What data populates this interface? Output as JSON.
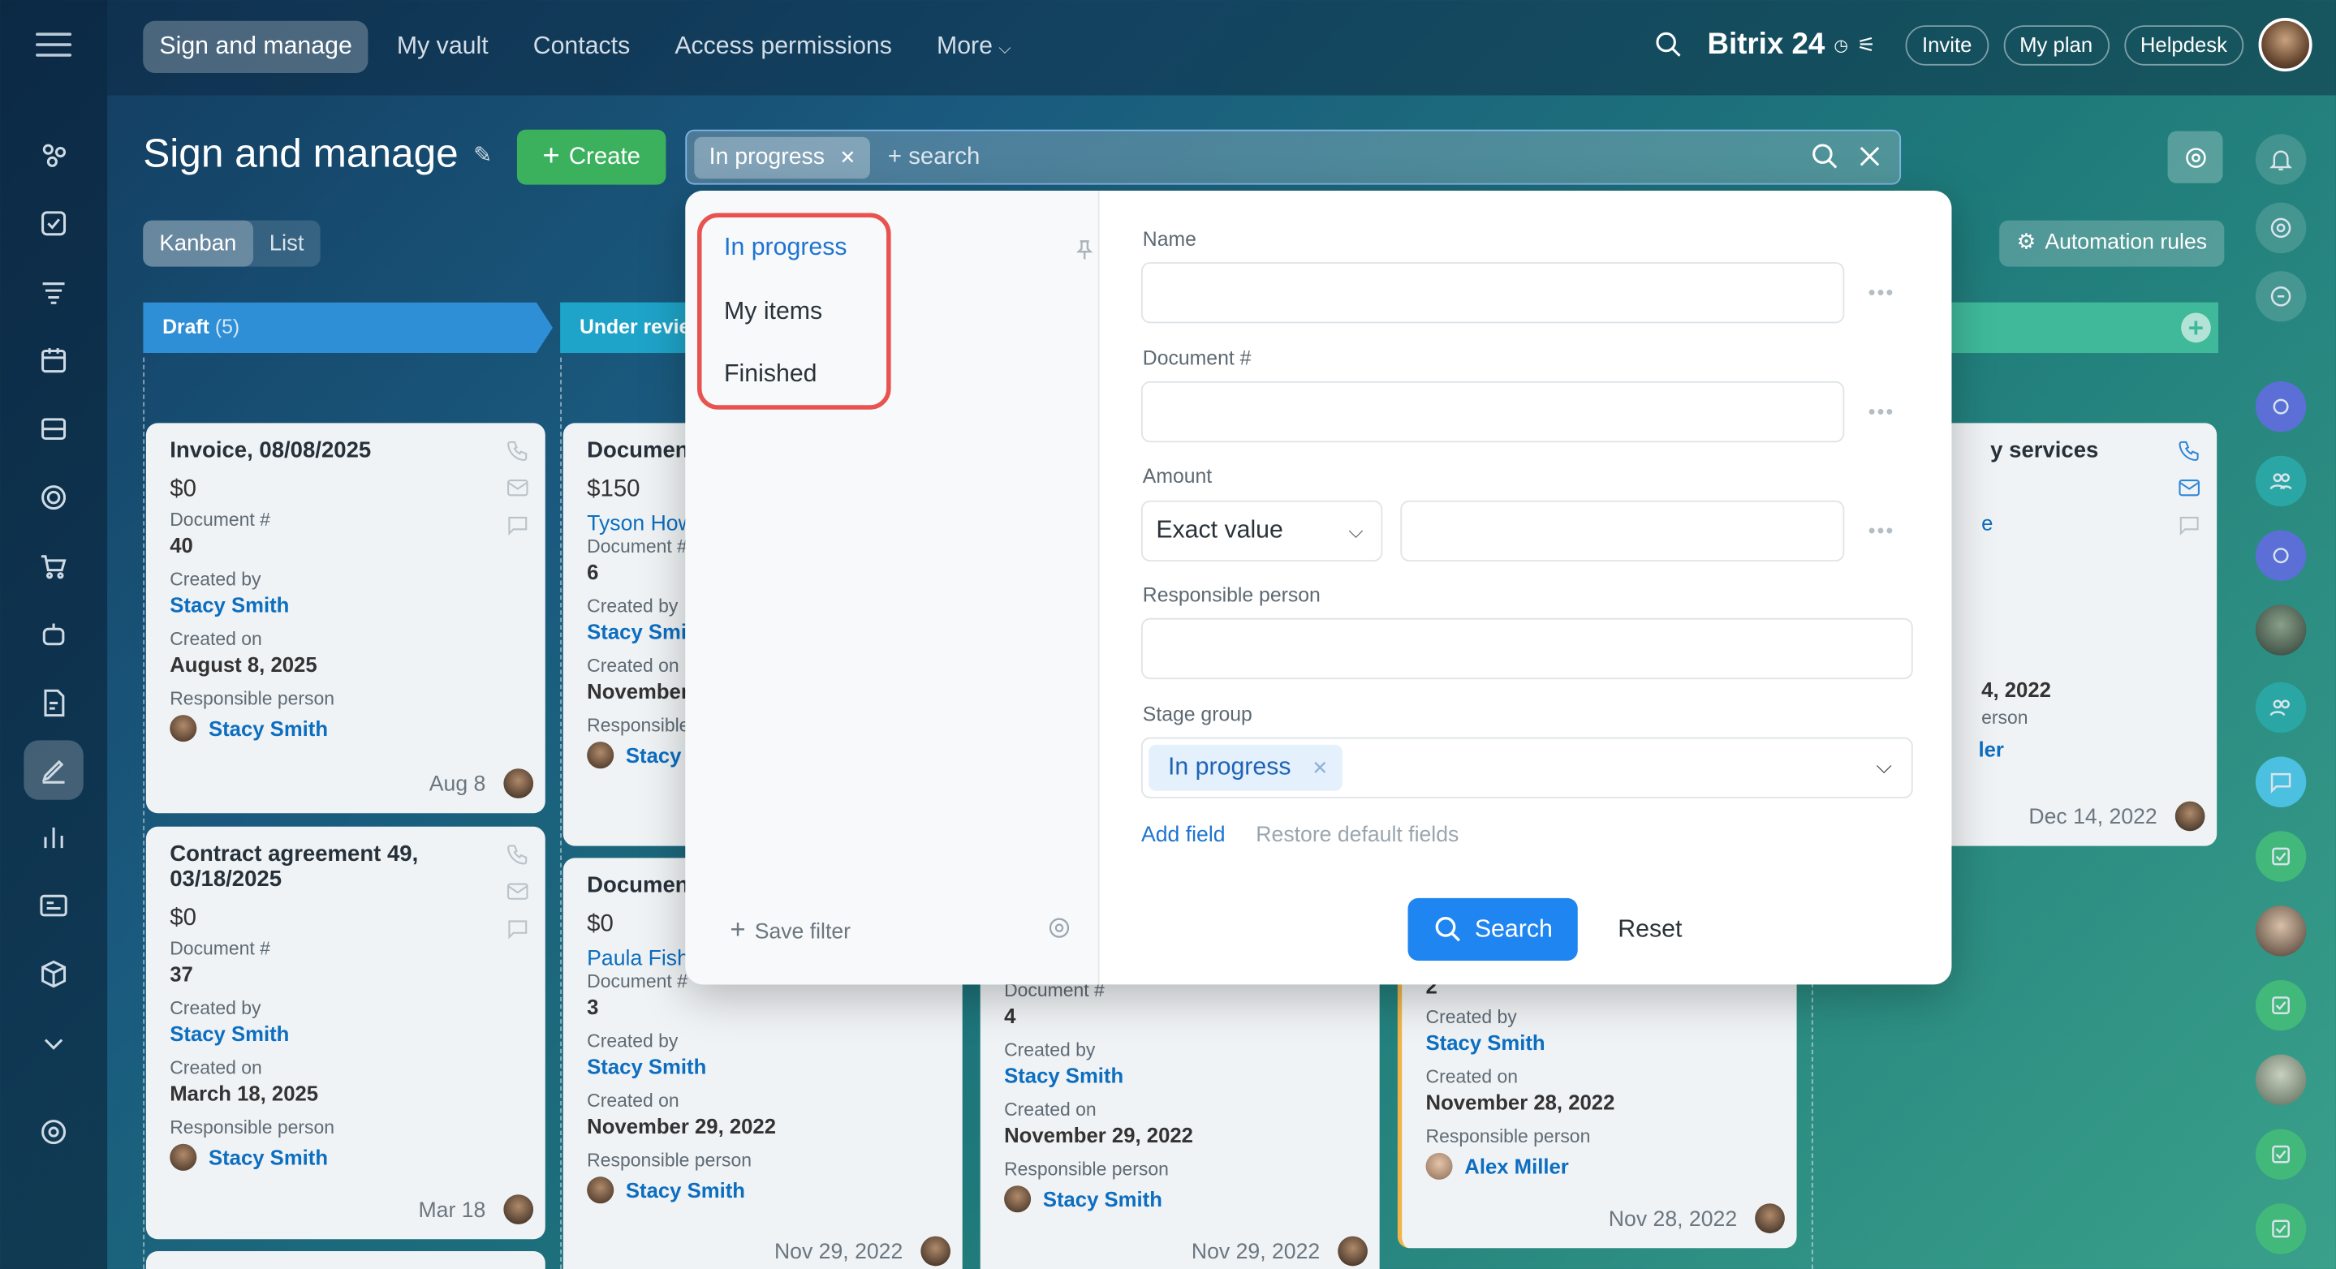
{
  "topnav": {
    "tabs": [
      {
        "label": "Sign and manage"
      },
      {
        "label": "My vault"
      },
      {
        "label": "Contacts"
      },
      {
        "label": "Access permissions"
      },
      {
        "label": "More"
      }
    ],
    "brand": "Bitrix 24",
    "invite": "Invite",
    "my_plan": "My plan",
    "helpdesk": "Helpdesk"
  },
  "page": {
    "title": "Sign and manage",
    "create_label": "Create",
    "view_kanban": "Kanban",
    "view_list": "List",
    "automation_rules": "Automation rules"
  },
  "search": {
    "chip": "In progress",
    "placeholder": "+ search"
  },
  "columns": [
    {
      "name": "Draft",
      "count": "(5)",
      "color": "#2f8fd6"
    },
    {
      "name": "Under revie",
      "color": "#1ea4c8"
    }
  ],
  "cards": {
    "c1": {
      "title": "Invoice, 08/08/2025",
      "amount": "$0",
      "docnum_label": "Document #",
      "docnum": "40",
      "created_by_label": "Created by",
      "created_by": "Stacy Smith",
      "created_on_label": "Created on",
      "created_on": "August 8, 2025",
      "resp_label": "Responsible person",
      "resp": "Stacy Smith",
      "date": "Aug 8"
    },
    "c2": {
      "title": "Contract agreement 49, 03/18/2025",
      "amount": "$0",
      "docnum_label": "Document #",
      "docnum": "37",
      "created_by_label": "Created by",
      "created_by": "Stacy Smith",
      "created_on_label": "Created on",
      "created_on": "March 18, 2025",
      "resp_label": "Responsible person",
      "resp": "Stacy Smith",
      "date": "Mar 18"
    },
    "c3": {
      "title": "Document",
      "amount": "$150",
      "client": "Tyson How",
      "docnum_label": "Document #",
      "docnum": "6",
      "created_by_label": "Created by",
      "created_by": "Stacy Smit",
      "created_on_label": "Created on",
      "created_on": "November",
      "resp_label": "Responsible",
      "resp": "Stacy"
    },
    "c4": {
      "title": "Document",
      "amount": "$0",
      "client": "Paula Fish",
      "docnum_label": "Document #",
      "docnum": "3",
      "created_by_label": "Created by",
      "created_by": "Stacy Smith",
      "created_on_label": "Created on",
      "created_on": "November 29, 2022",
      "resp_label": "Responsible person",
      "resp": "Stacy Smith",
      "date": "Nov 29, 2022"
    },
    "c5": {
      "docnum_label": "Document #",
      "docnum": "4",
      "created_by_label": "Created by",
      "created_by": "Stacy Smith",
      "created_on_label": "Created on",
      "created_on": "November 29, 2022",
      "resp_label": "Responsible person",
      "resp": "Stacy Smith",
      "date": "Nov 29, 2022"
    },
    "c6": {
      "docnum": "2",
      "created_by_label": "Created by",
      "created_by": "Stacy Smith",
      "created_on_label": "Created on",
      "created_on": "November 28, 2022",
      "resp_label": "Responsible person",
      "resp": "Alex Miller",
      "date": "Nov 28, 2022"
    },
    "c7": {
      "title": "y services",
      "client": "e",
      "created_on": "4, 2022",
      "resp_label": "erson",
      "resp": "ler",
      "date": "Dec 14, 2022"
    }
  },
  "filter": {
    "presets": [
      {
        "label": "In progress"
      },
      {
        "label": "My items"
      },
      {
        "label": "Finished"
      }
    ],
    "save_filter": "Save filter",
    "name_label": "Name",
    "docnum_label": "Document #",
    "amount_label": "Amount",
    "amount_mode": "Exact value",
    "resp_label": "Responsible person",
    "stage_label": "Stage group",
    "stage_value": "In progress",
    "add_field": "Add field",
    "restore": "Restore default fields",
    "search_btn": "Search",
    "reset_btn": "Reset"
  }
}
